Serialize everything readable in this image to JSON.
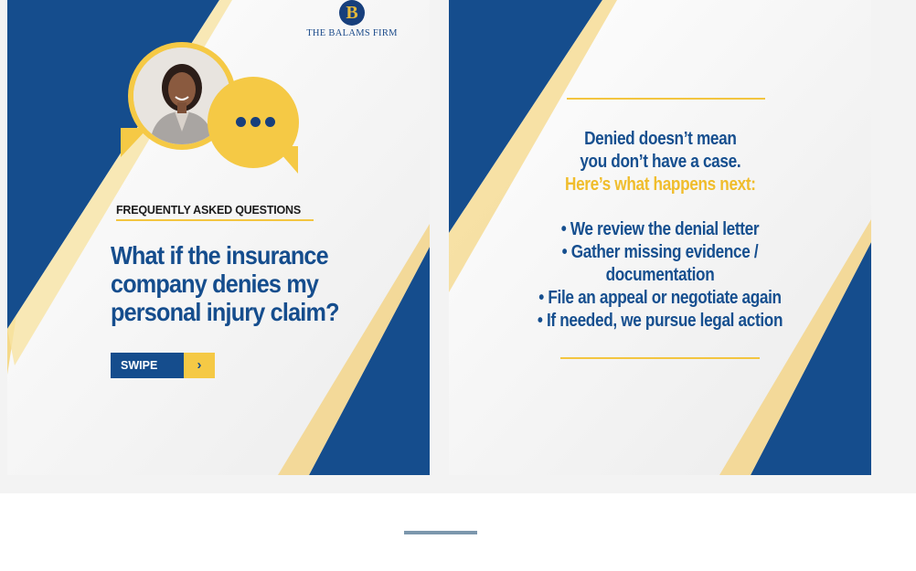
{
  "slide1": {
    "logo_mark": "B",
    "logo_text": "THE BALAMS FIRM",
    "eyebrow": "FREQUENTLY ASKED QUESTIONS",
    "question_lines": [
      "What if the insurance",
      "company denies my",
      "personal injury claim?"
    ],
    "swipe_label": "SWIPE",
    "swipe_arrow": "›"
  },
  "slide2": {
    "headline_lines": [
      "Denied doesn’t mean",
      "you don’t have a case."
    ],
    "subhead": "Here’s what happens next:",
    "bullets": [
      "• We review the denial letter",
      "• Gather missing evidence /",
      "documentation",
      "• File an appeal or negotiate again",
      "• If needed, we pursue legal action"
    ]
  },
  "colors": {
    "navy": "#154d8d",
    "gold": "#f5c945",
    "background": "#fbfbfb"
  },
  "icons": {
    "chat_dots": "ellipsis-icon",
    "swipe": "chevron-right-icon"
  },
  "carousel": {
    "slide_count": 2,
    "active_index": 0
  }
}
